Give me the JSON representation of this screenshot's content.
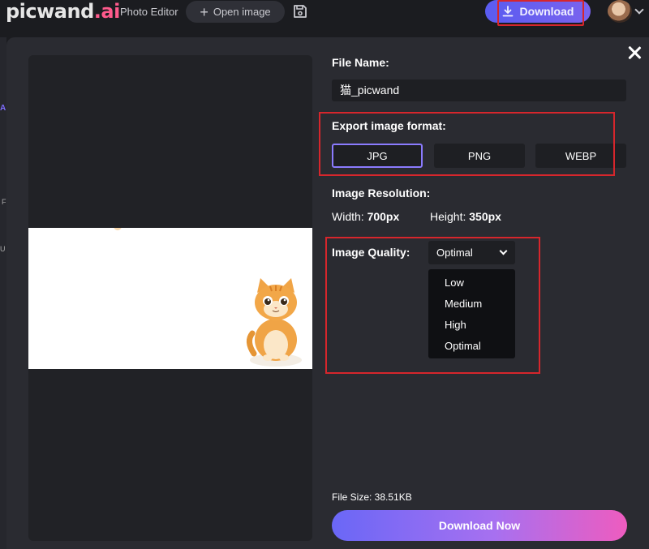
{
  "header": {
    "logo_main": "picwand",
    "logo_suffix": ".ai",
    "editor_label": "Photo Editor",
    "open_image_label": "Open image",
    "download_label": "Download"
  },
  "sidebar": {
    "partial_a": "A",
    "partial_f": "F",
    "partial_u": "U"
  },
  "dialog": {
    "file_name_label": "File Name:",
    "file_name_value": "猫_picwand",
    "export_format_label": "Export image format:",
    "formats": [
      {
        "label": "JPG",
        "selected": true
      },
      {
        "label": "PNG",
        "selected": false
      },
      {
        "label": "WEBP",
        "selected": false
      }
    ],
    "resolution_label": "Image Resolution:",
    "width_label": "Width:",
    "width_value": "700px",
    "height_label": "Height:",
    "height_value": "350px",
    "quality_label": "Image Quality:",
    "quality_selected": "Optimal",
    "quality_options": [
      "Low",
      "Medium",
      "High",
      "Optimal"
    ],
    "file_size_text": "File Size: 38.51KB",
    "download_now_label": "Download Now"
  },
  "colors": {
    "accent": "#8b7bff",
    "highlight_red": "#d6262c",
    "modal_bg": "#2a2b31"
  },
  "icons": [
    "plus-icon",
    "save-icon",
    "download-icon",
    "close-icon",
    "chevron-down-icon"
  ]
}
